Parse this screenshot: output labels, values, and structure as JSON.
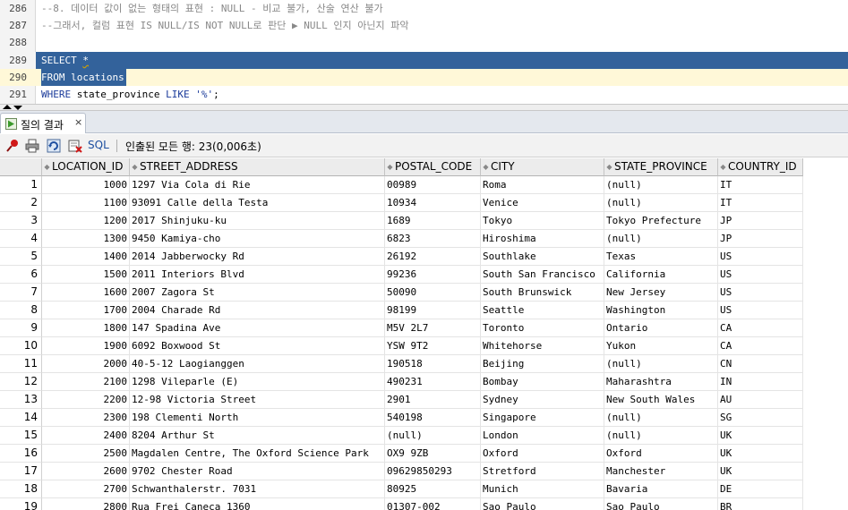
{
  "editor": {
    "lines": [
      {
        "n": "286",
        "text": "--8. 데이터 값이 없는 형태의 표현 : NULL - 비교 불가, 산술 연산 불가"
      },
      {
        "n": "287",
        "text": "--그래서, 컬럼 표현 IS NULL/IS NOT NULL로 판단 ▶ NULL 인지 아닌지 파악"
      },
      {
        "n": "288",
        "text": ""
      },
      {
        "n": "289",
        "text_a": "SELECT ",
        "text_b": "*"
      },
      {
        "n": "290",
        "text": "FROM locations"
      },
      {
        "n": "291",
        "kw1": "WHERE",
        "mid": " state_province ",
        "kw2": "LIKE",
        "str": " '%'",
        "end": ";"
      }
    ]
  },
  "result_tab": {
    "label": "질의 결과",
    "close": "×",
    "icon": "query-result-icon"
  },
  "toolbar": {
    "icons": [
      "pin-icon",
      "print-icon",
      "refresh-icon",
      "export-icon"
    ],
    "sql_label": "SQL",
    "status": "인출된 모든 행: 23(0,006초)"
  },
  "columns": [
    "LOCATION_ID",
    "STREET_ADDRESS",
    "POSTAL_CODE",
    "CITY",
    "STATE_PROVINCE",
    "COUNTRY_ID"
  ],
  "rows": [
    {
      "n": "1",
      "id": "1000",
      "street": "1297 Via Cola di Rie",
      "postal": "00989",
      "city": "Roma",
      "state": "(null)",
      "country": "IT"
    },
    {
      "n": "2",
      "id": "1100",
      "street": "93091 Calle della Testa",
      "postal": "10934",
      "city": "Venice",
      "state": "(null)",
      "country": "IT"
    },
    {
      "n": "3",
      "id": "1200",
      "street": "2017 Shinjuku-ku",
      "postal": "1689",
      "city": "Tokyo",
      "state": "Tokyo Prefecture",
      "country": "JP"
    },
    {
      "n": "4",
      "id": "1300",
      "street": "9450 Kamiya-cho",
      "postal": "6823",
      "city": "Hiroshima",
      "state": "(null)",
      "country": "JP"
    },
    {
      "n": "5",
      "id": "1400",
      "street": "2014 Jabberwocky Rd",
      "postal": "26192",
      "city": "Southlake",
      "state": "Texas",
      "country": "US"
    },
    {
      "n": "6",
      "id": "1500",
      "street": "2011 Interiors Blvd",
      "postal": "99236",
      "city": "South San Francisco",
      "state": "California",
      "country": "US"
    },
    {
      "n": "7",
      "id": "1600",
      "street": "2007 Zagora St",
      "postal": "50090",
      "city": "South Brunswick",
      "state": "New Jersey",
      "country": "US"
    },
    {
      "n": "8",
      "id": "1700",
      "street": "2004 Charade Rd",
      "postal": "98199",
      "city": "Seattle",
      "state": "Washington",
      "country": "US"
    },
    {
      "n": "9",
      "id": "1800",
      "street": "147 Spadina Ave",
      "postal": "M5V 2L7",
      "city": "Toronto",
      "state": "Ontario",
      "country": "CA"
    },
    {
      "n": "10",
      "id": "1900",
      "street": "6092 Boxwood St",
      "postal": "YSW 9T2",
      "city": "Whitehorse",
      "state": "Yukon",
      "country": "CA"
    },
    {
      "n": "11",
      "id": "2000",
      "street": "40-5-12 Laogianggen",
      "postal": "190518",
      "city": "Beijing",
      "state": "(null)",
      "country": "CN"
    },
    {
      "n": "12",
      "id": "2100",
      "street": "1298 Vileparle (E)",
      "postal": "490231",
      "city": "Bombay",
      "state": "Maharashtra",
      "country": "IN"
    },
    {
      "n": "13",
      "id": "2200",
      "street": "12-98 Victoria Street",
      "postal": "2901",
      "city": "Sydney",
      "state": "New South Wales",
      "country": "AU"
    },
    {
      "n": "14",
      "id": "2300",
      "street": "198 Clementi North",
      "postal": "540198",
      "city": "Singapore",
      "state": "(null)",
      "country": "SG"
    },
    {
      "n": "15",
      "id": "2400",
      "street": "8204 Arthur St",
      "postal": "(null)",
      "city": "London",
      "state": "(null)",
      "country": "UK"
    },
    {
      "n": "16",
      "id": "2500",
      "street": "Magdalen Centre, The Oxford Science Park",
      "postal": "OX9 9ZB",
      "city": "Oxford",
      "state": "Oxford",
      "country": "UK"
    },
    {
      "n": "17",
      "id": "2600",
      "street": "9702 Chester Road",
      "postal": "09629850293",
      "city": "Stretford",
      "state": "Manchester",
      "country": "UK"
    },
    {
      "n": "18",
      "id": "2700",
      "street": "Schwanthalerstr. 7031",
      "postal": "80925",
      "city": "Munich",
      "state": "Bavaria",
      "country": "DE"
    },
    {
      "n": "19",
      "id": "2800",
      "street": "Rua Frei Caneca 1360",
      "postal": "01307-002",
      "city": "Sao Paulo",
      "state": "Sao Paulo",
      "country": "BR"
    }
  ]
}
